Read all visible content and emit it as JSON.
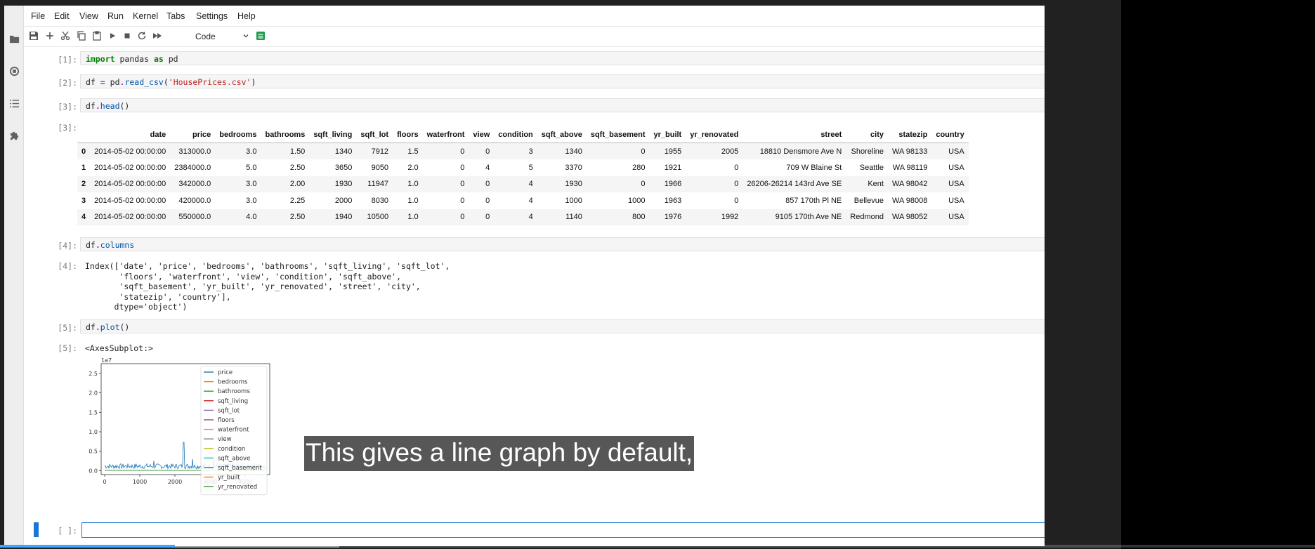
{
  "menu": [
    "File",
    "Edit",
    "View",
    "Run",
    "Kernel",
    "Tabs",
    "Settings",
    "Help"
  ],
  "toolbar": {
    "cell_type": "Code"
  },
  "cells": [
    {
      "in_prompt": "[1]:",
      "code_html": "<span class=\"kw\">import</span> pandas <span class=\"kw\">as</span> pd"
    },
    {
      "in_prompt": "[2]:",
      "code_html": "df <span class=\"op\">=</span> pd<span class=\"op\">.</span><span class=\"fn\">read_csv</span>(<span class=\"str\">'HousePrices.csv'</span>)"
    },
    {
      "in_prompt": "[3]:",
      "code_html": "df<span class=\"op\">.</span><span class=\"fn\">head</span>()"
    },
    {
      "in_prompt": "[4]:",
      "code_html": "df<span class=\"op\">.</span><span class=\"fn\">columns</span>"
    },
    {
      "in_prompt": "[5]:",
      "code_html": "df<span class=\"op\">.</span><span class=\"fn\">plot</span>()"
    }
  ],
  "out_prompts": {
    "out3": "[3]:",
    "out4": "[4]:",
    "out5": "[5]:"
  },
  "dataframe": {
    "columns": [
      "",
      "date",
      "price",
      "bedrooms",
      "bathrooms",
      "sqft_living",
      "sqft_lot",
      "floors",
      "waterfront",
      "view",
      "condition",
      "sqft_above",
      "sqft_basement",
      "yr_built",
      "yr_renovated",
      "street",
      "city",
      "statezip",
      "country"
    ],
    "rows": [
      [
        "0",
        "2014-05-02 00:00:00",
        "313000.0",
        "3.0",
        "1.50",
        "1340",
        "7912",
        "1.5",
        "0",
        "0",
        "3",
        "1340",
        "0",
        "1955",
        "2005",
        "18810 Densmore Ave N",
        "Shoreline",
        "WA 98133",
        "USA"
      ],
      [
        "1",
        "2014-05-02 00:00:00",
        "2384000.0",
        "5.0",
        "2.50",
        "3650",
        "9050",
        "2.0",
        "0",
        "4",
        "5",
        "3370",
        "280",
        "1921",
        "0",
        "709 W Blaine St",
        "Seattle",
        "WA 98119",
        "USA"
      ],
      [
        "2",
        "2014-05-02 00:00:00",
        "342000.0",
        "3.0",
        "2.00",
        "1930",
        "11947",
        "1.0",
        "0",
        "0",
        "4",
        "1930",
        "0",
        "1966",
        "0",
        "26206-26214 143rd Ave SE",
        "Kent",
        "WA 98042",
        "USA"
      ],
      [
        "3",
        "2014-05-02 00:00:00",
        "420000.0",
        "3.0",
        "2.25",
        "2000",
        "8030",
        "1.0",
        "0",
        "0",
        "4",
        "1000",
        "1000",
        "1963",
        "0",
        "857 170th Pl NE",
        "Bellevue",
        "WA 98008",
        "USA"
      ],
      [
        "4",
        "2014-05-02 00:00:00",
        "550000.0",
        "4.0",
        "2.50",
        "1940",
        "10500",
        "1.0",
        "0",
        "0",
        "4",
        "1140",
        "800",
        "1976",
        "1992",
        "9105 170th Ave NE",
        "Redmond",
        "WA 98052",
        "USA"
      ]
    ]
  },
  "columns_output": "Index(['date', 'price', 'bedrooms', 'bathrooms', 'sqft_living', 'sqft_lot',\n       'floors', 'waterfront', 'view', 'condition', 'sqft_above',\n       'sqft_basement', 'yr_built', 'yr_renovated', 'street', 'city',\n       'statezip', 'country'],\n      dtype='object')",
  "plot_output": "<AxesSubplot:>",
  "chart_data": {
    "type": "line",
    "title": "",
    "xlabel": "",
    "ylabel": "",
    "y_offset_label": "1e7",
    "xlim": [
      -100,
      4700
    ],
    "ylim": [
      -0.1,
      2.75
    ],
    "x_ticks": [
      0,
      1000,
      2000,
      3000,
      4000
    ],
    "x_tick_labels": [
      "0",
      "1000",
      "2000",
      "3000",
      "4000"
    ],
    "y_ticks": [
      0.0,
      0.5,
      1.0,
      1.5,
      2.0,
      2.5
    ],
    "y_tick_labels": [
      "0.0",
      "0.5",
      "1.0",
      "1.5",
      "2.0",
      "2.5"
    ],
    "legend_position": "top-right",
    "series": [
      {
        "name": "price",
        "color": "#1f77b4"
      },
      {
        "name": "bedrooms",
        "color": "#ff7f0e"
      },
      {
        "name": "bathrooms",
        "color": "#2ca02c"
      },
      {
        "name": "sqft_living",
        "color": "#d62728"
      },
      {
        "name": "sqft_lot",
        "color": "#9467bd"
      },
      {
        "name": "floors",
        "color": "#8c564b"
      },
      {
        "name": "waterfront",
        "color": "#e377c2"
      },
      {
        "name": "view",
        "color": "#7f7f7f"
      },
      {
        "name": "condition",
        "color": "#bcbd22"
      },
      {
        "name": "sqft_above",
        "color": "#17becf"
      },
      {
        "name": "sqft_basement",
        "color": "#1f77b4"
      },
      {
        "name": "yr_built",
        "color": "#ff7f0e"
      },
      {
        "name": "yr_renovated",
        "color": "#2ca02c"
      }
    ],
    "dominant_series_peaks": [
      [
        1400,
        0.25
      ],
      [
        2250,
        0.73
      ],
      [
        2500,
        0.3
      ],
      [
        3100,
        0.28
      ]
    ]
  },
  "caption": "This gives a line graph by default,",
  "empty_prompt": "[ ]:",
  "video": {
    "played_fraction": 0.133,
    "buffered_fraction": 0.258
  }
}
